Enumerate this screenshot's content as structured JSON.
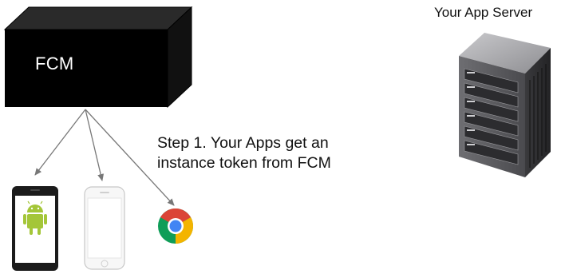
{
  "fcm_box": {
    "label": "FCM",
    "color": "#000000"
  },
  "step_caption": {
    "line1": "Step 1. Your Apps get an",
    "line2": "instance token from FCM"
  },
  "server": {
    "label": "Your App Server",
    "icon": "server-rack-icon"
  },
  "devices": [
    {
      "icon": "android-phone-icon"
    },
    {
      "icon": "iphone-icon"
    },
    {
      "icon": "chrome-browser-icon"
    }
  ],
  "colors": {
    "arrow": "#777777",
    "android_green": "#a4c639",
    "chrome_red": "#db4437",
    "chrome_yellow": "#f4b400",
    "chrome_green": "#0f9d58",
    "chrome_blue": "#4285f4"
  }
}
